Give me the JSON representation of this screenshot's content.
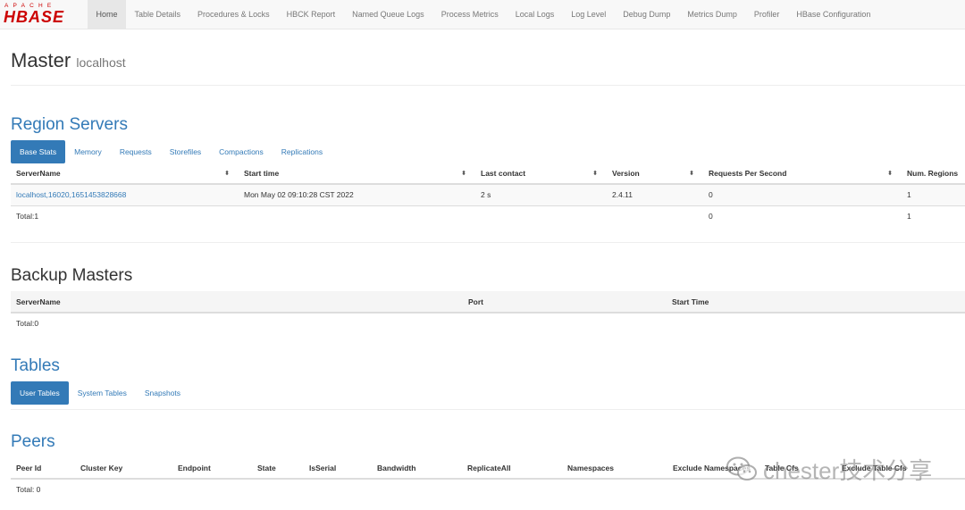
{
  "logo": {
    "top": "APACHE",
    "main": "HBASE"
  },
  "nav": [
    {
      "label": "Home",
      "active": true
    },
    {
      "label": "Table Details"
    },
    {
      "label": "Procedures & Locks"
    },
    {
      "label": "HBCK Report"
    },
    {
      "label": "Named Queue Logs"
    },
    {
      "label": "Process Metrics"
    },
    {
      "label": "Local Logs"
    },
    {
      "label": "Log Level"
    },
    {
      "label": "Debug Dump"
    },
    {
      "label": "Metrics Dump"
    },
    {
      "label": "Profiler"
    },
    {
      "label": "HBase Configuration"
    }
  ],
  "header": {
    "title": "Master",
    "host": "localhost"
  },
  "region_servers": {
    "title": "Region Servers",
    "tabs": [
      "Base Stats",
      "Memory",
      "Requests",
      "Storefiles",
      "Compactions",
      "Replications"
    ],
    "columns": [
      "ServerName",
      "Start time",
      "Last contact",
      "Version",
      "Requests Per Second",
      "Num. Regions"
    ],
    "row": {
      "server": "localhost,16020,1651453828668",
      "start": "Mon May 02 09:10:28 CST 2022",
      "last_contact": "2 s",
      "version": "2.4.11",
      "rps": "0",
      "regions": "1"
    },
    "total": {
      "label": "Total:1",
      "rps": "0",
      "regions": "1"
    }
  },
  "backup_masters": {
    "title": "Backup Masters",
    "columns": [
      "ServerName",
      "Port",
      "Start Time"
    ],
    "total": "Total:0"
  },
  "tables": {
    "title": "Tables",
    "tabs": [
      "User Tables",
      "System Tables",
      "Snapshots"
    ]
  },
  "peers": {
    "title": "Peers",
    "columns": [
      "Peer Id",
      "Cluster Key",
      "Endpoint",
      "State",
      "IsSerial",
      "Bandwidth",
      "ReplicateAll",
      "Namespaces",
      "Exclude Namespaces",
      "Table Cfs",
      "Exclude Table Cfs"
    ],
    "total": "Total: 0"
  },
  "watermark": "chester技术分享",
  "colors": {
    "brand_red": "#cc0000",
    "link_blue": "#337ab7",
    "navbar_bg": "#f8f8f8"
  }
}
